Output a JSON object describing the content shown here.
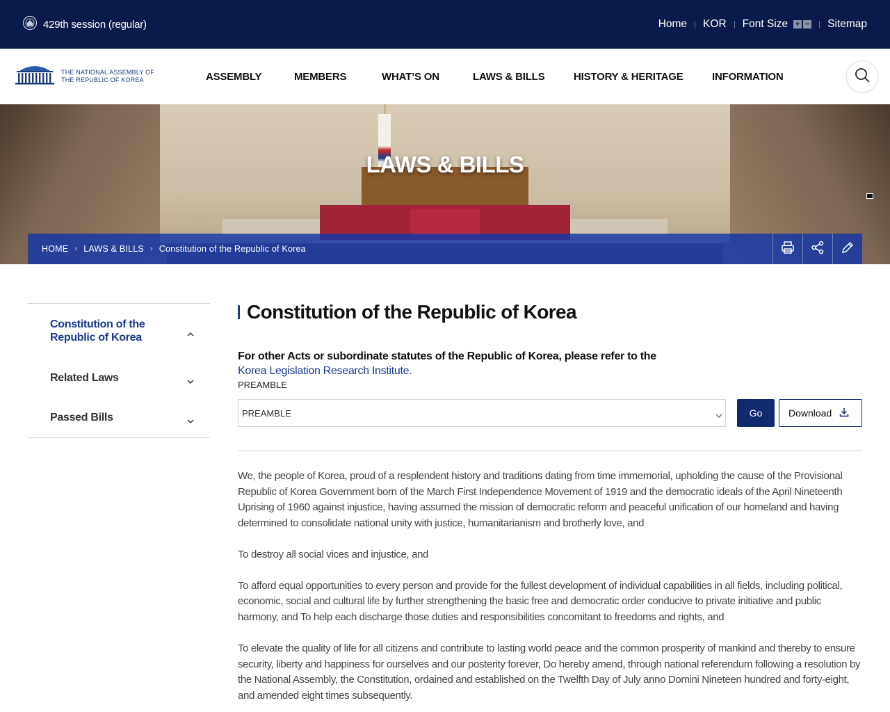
{
  "header": {
    "session": "429th session (regular)",
    "utility_links": [
      "Home",
      "KOR",
      "Font Size",
      "Sitemap"
    ],
    "font_size_increase": "+",
    "font_size_decrease": "−"
  },
  "logo": {
    "line1": "THE NATIONAL ASSEMBLY OF",
    "line2": "THE REPUBLIC OF KOREA"
  },
  "nav": {
    "items": [
      "ASSEMBLY",
      "MEMBERS",
      "WHAT’S ON",
      "LAWS & BILLS",
      "HISTORY & HERITAGE",
      "INFORMATION"
    ]
  },
  "hero": {
    "title": "LAWS & BILLS"
  },
  "breadcrumb": {
    "items": [
      "HOME",
      "LAWS & BILLS",
      "Constitution of the Republic of Korea"
    ]
  },
  "sidebar": {
    "items": [
      {
        "label": "Constitution of the Republic of Korea",
        "active": true
      },
      {
        "label": "Related Laws",
        "active": false
      },
      {
        "label": "Passed Bills",
        "active": false
      }
    ]
  },
  "main": {
    "title": "Constitution of the Republic of Korea",
    "notice": "For other Acts or subordinate statutes of the Republic of Korea, please refer to the",
    "notice_link": "Korea Legislation Research Institute",
    "notice_end": ".",
    "select_label": "PREAMBLE",
    "select_value": "PREAMBLE",
    "go_label": "Go",
    "download_label": "Download",
    "paragraphs": [
      "We, the people of Korea, proud of a resplendent history and traditions dating from time immemorial, upholding the cause of the Provisional Republic of Korea Government born of the March First Independence Movement of 1919 and the democratic ideals of the April Nineteenth Uprising of 1960 against injustice, having assumed the mission of democratic reform and peaceful unification of our homeland and having determined to consolidate national unity with justice, humanitarianism and brotherly love, and",
      "To destroy all social vices and injustice, and",
      "To afford equal opportunities to every person and provide for the fullest development of individual capabilities in all fields, including political, economic, social and cultural life by further strengthening the basic free and democratic order conducive to private initiative and public harmony, and To help each discharge those duties and responsibilities concomitant to freedoms and rights, and",
      "To elevate the quality of life for all citizens and contribute to lasting world peace and the common prosperity of mankind and thereby to ensure security, liberty and happiness for ourselves and our posterity forever, Do hereby amend, through national referendum following a resolution by the National Assembly, the Constitution, ordained and established on the Twelfth Day of July anno Domini Nineteen hundred and forty-eight, and amended eight times subsequently."
    ]
  },
  "colors": {
    "topbar": "#0b1a4c",
    "accent": "#1b3a8f",
    "button": "#0f2a6e",
    "crumbbar": "#1436a8"
  },
  "icons": [
    "assembly-emblem-icon",
    "search-icon",
    "print-icon",
    "share-icon",
    "edit-icon",
    "chevron-up-icon",
    "chevron-down-icon",
    "download-icon"
  ]
}
